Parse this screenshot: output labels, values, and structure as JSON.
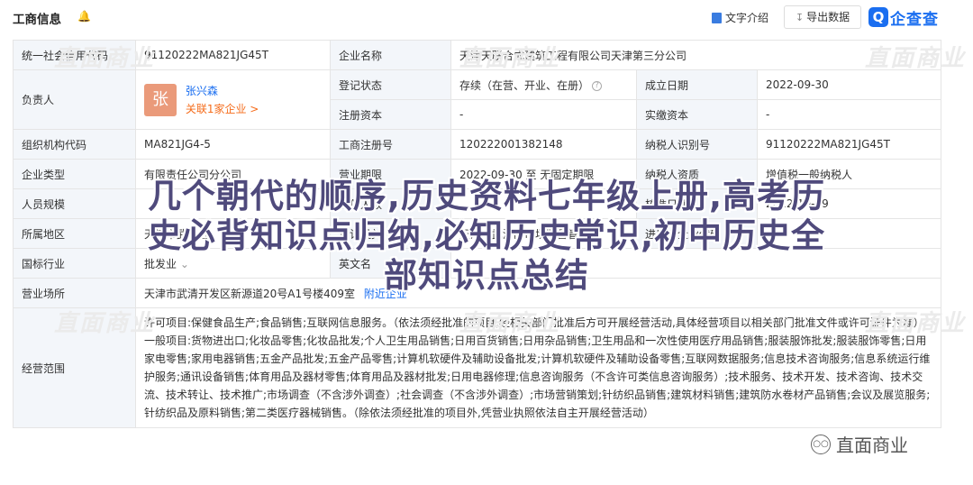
{
  "header": {
    "title": "工商信息",
    "text_intro": "文字介绍",
    "export_label": "导出数据",
    "logo_text": "企查查",
    "logo_mark": "Q"
  },
  "table": {
    "credit_code_label": "统一社会信用代码",
    "credit_code": "91120222MA821JG45T",
    "company_name_label": "企业名称",
    "company_name": "天津天联合成建筑工程有限公司天津第三分公司",
    "legal_rep_label": "负责人",
    "legal_rep_avatar": "张",
    "legal_rep_name": "张兴森",
    "legal_rep_link": "关联1家企业 >",
    "reg_status_label": "登记状态",
    "reg_status": "存续（在营、开业、在册）",
    "est_date_label": "成立日期",
    "est_date": "2022-09-30",
    "reg_capital_label": "注册资本",
    "reg_capital": "-",
    "paid_capital_label": "实缴资本",
    "paid_capital": "-",
    "org_code_label": "组织机构代码",
    "org_code": "MA821JG4-5",
    "reg_no_label": "工商注册号",
    "reg_no": "120222001382148",
    "tax_id_label": "纳税人识别号",
    "tax_id": "91120222MA821JG45T",
    "company_type_label": "企业类型",
    "company_type": "有限责任公司分公司",
    "biz_term_label": "营业期限",
    "biz_term": "2022-09-30 至 无固定期限",
    "taxpayer_qual_label": "纳税人资质",
    "taxpayer_qual": "增值税一般纳税人",
    "staff_size_label": "人员规模",
    "staff_size": "",
    "insured_label": "参保人数",
    "insured": "",
    "approval_date_label": "核准日期",
    "approval_date": "2022-10-19",
    "region_label": "所属地区",
    "region": "天津市武清区",
    "authority_label": "登记机关",
    "authority": "天津市武清区市场监督管理局",
    "import_export_label": "进出口企业代码",
    "import_export": "",
    "industry_label": "国标行业",
    "industry": "批发业",
    "english_name_label": "英文名",
    "english_name": "",
    "address_label": "营业场所",
    "address": "天津市武清开发区新源道20号A1号楼409室",
    "nearby_link": "附近企业",
    "scope_label": "经营范围",
    "scope": "许可项目:保健食品生产;食品销售;互联网信息服务。（依法须经批准的项目,经相关部门批准后方可开展经营活动,具体经营项目以相关部门批准文件或许可证件为准）一般项目:货物进出口;化妆品零售;化妆品批发;个人卫生用品销售;日用百货销售;日用杂品销售;卫生用品和一次性使用医疗用品销售;服装服饰批发;服装服饰零售;日用家电零售;家用电器销售;五金产品批发;五金产品零售;计算机软硬件及辅助设备批发;计算机软硬件及辅助设备零售;互联网数据服务;信息技术咨询服务;信息系统运行维护服务;通讯设备销售;体育用品及器材零售;体育用品及器材批发;日用电器修理;信息咨询服务（不含许可类信息咨询服务）;技术服务、技术开发、技术咨询、技术交流、技术转让、技术推广;市场调查（不含涉外调查）;社会调查（不含涉外调查）;市场营销策划;针纺织品销售;建筑材料销售;建筑防水卷材产品销售;会议及展览服务;针纺织品及原料销售;第二类医疗器械销售。（除依法须经批准的项目外,凭营业执照依法自主开展经营活动）"
  },
  "watermark": {
    "text": "直面商业",
    "corner_text": "直面商业"
  },
  "overlay": {
    "lines": [
      "几个朝代的顺序,历史资料七年级上册,高考历",
      "史必背知识点归纳,必知历史常识,初中历史全",
      "部知识点总结"
    ]
  }
}
